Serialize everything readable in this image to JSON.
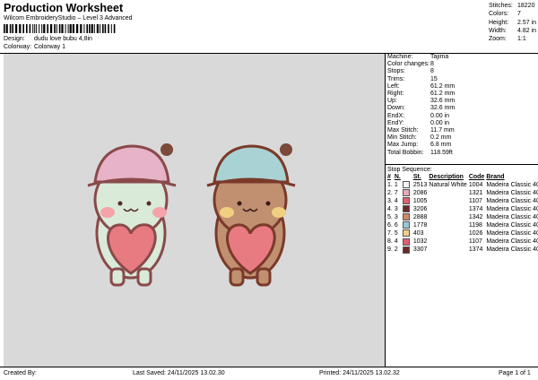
{
  "header": {
    "title": "Production Worksheet",
    "subtitle": "Wilcom EmbroideryStudio – Level 3 Advanced"
  },
  "design": {
    "label": "Design:",
    "value": "dudu love bubu 4,8in"
  },
  "colorway": {
    "label": "Colorway:",
    "value": "Colorway 1"
  },
  "summary": [
    {
      "label": "Stitches:",
      "value": "18220"
    },
    {
      "label": "Colors:",
      "value": "7"
    },
    {
      "label": "Height:",
      "value": "2.57 in"
    },
    {
      "label": "Width:",
      "value": "4.82 in"
    },
    {
      "label": "Zoom:",
      "value": "1:1"
    }
  ],
  "details": [
    {
      "label": "Machine:",
      "value": "Tajima"
    },
    {
      "label": "Color changes:",
      "value": "8"
    },
    {
      "label": "Stops:",
      "value": "8"
    },
    {
      "label": "Trims:",
      "value": "15"
    },
    {
      "label": "Left:",
      "value": "61.2 mm"
    },
    {
      "label": "Right:",
      "value": "61.2 mm"
    },
    {
      "label": "Up:",
      "value": "32.6 mm"
    },
    {
      "label": "Down:",
      "value": "32.6 mm"
    },
    {
      "label": "EndX:",
      "value": "0.00 in"
    },
    {
      "label": "EndY:",
      "value": "0.00 in"
    },
    {
      "label": "Max Stitch:",
      "value": "11.7 mm"
    },
    {
      "label": "Min Stitch:",
      "value": "0.2 mm"
    },
    {
      "label": "Max Jump:",
      "value": "6.8 mm"
    },
    {
      "label": "Total Bobbin:",
      "value": "118.59ft"
    }
  ],
  "stop_sequence": {
    "title": "Stop Sequence:",
    "headers": [
      "#",
      "N.",
      "St.",
      "Description",
      "Code",
      "Brand"
    ],
    "rows": [
      {
        "num": "1.",
        "n": "1",
        "color": "#f4f4f4",
        "st": "2513",
        "desc": "Natural White",
        "code": "1004",
        "brand": "Madeira Classic 40"
      },
      {
        "num": "2.",
        "n": "7",
        "color": "#e7a9b8",
        "st": "2086",
        "desc": "",
        "code": "1321",
        "brand": "Madeira Classic 40"
      },
      {
        "num": "3.",
        "n": "4",
        "color": "#e0606e",
        "st": "1005",
        "desc": "",
        "code": "1107",
        "brand": "Madeira Classic 40"
      },
      {
        "num": "4.",
        "n": "3",
        "color": "#6b2a2a",
        "st": "3206",
        "desc": "",
        "code": "1374",
        "brand": "Madeira Classic 40"
      },
      {
        "num": "5.",
        "n": "3",
        "color": "#c98a6a",
        "st": "2888",
        "desc": "",
        "code": "1342",
        "brand": "Madeira Classic 40"
      },
      {
        "num": "6.",
        "n": "6",
        "color": "#9cc9cf",
        "st": "1778",
        "desc": "",
        "code": "1198",
        "brand": "Madeira Classic 40"
      },
      {
        "num": "7.",
        "n": "5",
        "color": "#f1d08a",
        "st": "403",
        "desc": "",
        "code": "1026",
        "brand": "Madeira Classic 40"
      },
      {
        "num": "8.",
        "n": "4",
        "color": "#e0606e",
        "st": "1032",
        "desc": "",
        "code": "1107",
        "brand": "Madeira Classic 40"
      },
      {
        "num": "9.",
        "n": "2",
        "color": "#6b2a2a",
        "st": "3307",
        "desc": "",
        "code": "1374",
        "brand": "Madeira Classic 40"
      }
    ]
  },
  "footer": {
    "created_by": "Created By:",
    "last_saved": "Last Saved: 24/11/2025 13.02.30",
    "printed": "Printed: 24/11/2025 13.02.32",
    "page": "Page 1 of 1"
  }
}
